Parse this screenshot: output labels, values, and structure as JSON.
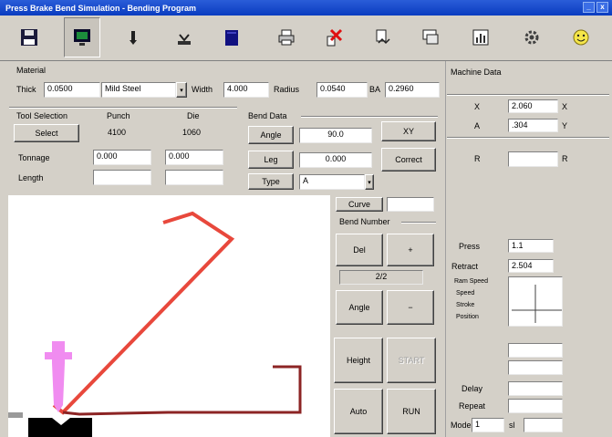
{
  "window": {
    "title": "Press Brake Bend Simulation - Bending Program"
  },
  "toolbar": {
    "tools": [
      {
        "name": "save-tool",
        "icon": "save-icon",
        "caption": ""
      },
      {
        "name": "machine-tool",
        "icon": "monitor-icon",
        "caption": ""
      },
      {
        "name": "punch-tool",
        "icon": "punch-icon",
        "caption": ""
      },
      {
        "name": "die-tool",
        "icon": "die-icon",
        "caption": ""
      },
      {
        "name": "book-tool",
        "icon": "book-icon",
        "caption": ""
      },
      {
        "name": "print-tool",
        "icon": "printer-icon",
        "caption": ""
      },
      {
        "name": "delete-tool",
        "icon": "delete-icon",
        "caption": ""
      },
      {
        "name": "sequence-tool",
        "icon": "sequence-icon",
        "caption": ""
      },
      {
        "name": "window-tool",
        "icon": "window-icon",
        "caption": ""
      },
      {
        "name": "chart-tool",
        "icon": "chart-icon",
        "caption": ""
      },
      {
        "name": "settings-tool",
        "icon": "gear-icon",
        "caption": ""
      },
      {
        "name": "smile-tool",
        "icon": "smiley-icon",
        "caption": ""
      }
    ]
  },
  "material": {
    "section_label": "Material",
    "thick_label": "Thick",
    "thick_value": "0.0500",
    "type_value": "Mild Steel",
    "width_label": "Width",
    "width_value": "4.000",
    "radius_label": "Radius",
    "radius_value": "0.0540",
    "ba_label": "BA",
    "ba_value": "0.2960"
  },
  "tooling": {
    "section_label": "Tool Selection",
    "punch_header": "Punch",
    "die_header": "Die",
    "select_button": "Select",
    "punch_id": "4100",
    "die_id": "1060",
    "tonnage_label": "Tonnage",
    "punch_tonnage": "0.000",
    "die_tonnage": "0.000",
    "length_label": "Length",
    "punch_length": "",
    "die_length": ""
  },
  "bend_data": {
    "section_label": "Bend Data",
    "angle_label": "Angle",
    "angle_value": "90.0",
    "leg_label": "Leg",
    "leg_value": "0.000",
    "type_label": "Type",
    "type_value": "A",
    "xy_button": "XY",
    "correct_button": "Correct",
    "curve_button": "Curve",
    "curve_value": ""
  },
  "bend_number": {
    "section_label": "Bend Number",
    "delete_button": "Del",
    "add_button": "+",
    "count_value": "2/2",
    "angle_button": "Angle",
    "minus_button": "−"
  },
  "actions": {
    "height_button": "Height",
    "start_button": "START",
    "auto_button": "Auto",
    "run_button": "RUN"
  },
  "machine_data": {
    "section_label": "Machine Data",
    "x_label": "X",
    "x_value": "2.060",
    "x_unit": "X",
    "a_label": "A",
    "a_value": ".304",
    "a_unit": "Y",
    "r_label": "R",
    "r_value": "",
    "r_unit": "R",
    "press_label": "Press",
    "press_value": "1.1",
    "retract_label": "Retract",
    "retract_value": "2.504",
    "ram_label": "Ram Speed",
    "speed_label": "Speed",
    "speed_value": "",
    "stroke_label": "Stroke",
    "stroke_value": "",
    "position_label": "Position",
    "position_value": "",
    "delay_label": "Delay",
    "delay_value": "",
    "repeat_label": "Repeat",
    "repeat_value": "",
    "mode_label": "Mode",
    "mode_value": "1",
    "mode_extra": "sl"
  }
}
